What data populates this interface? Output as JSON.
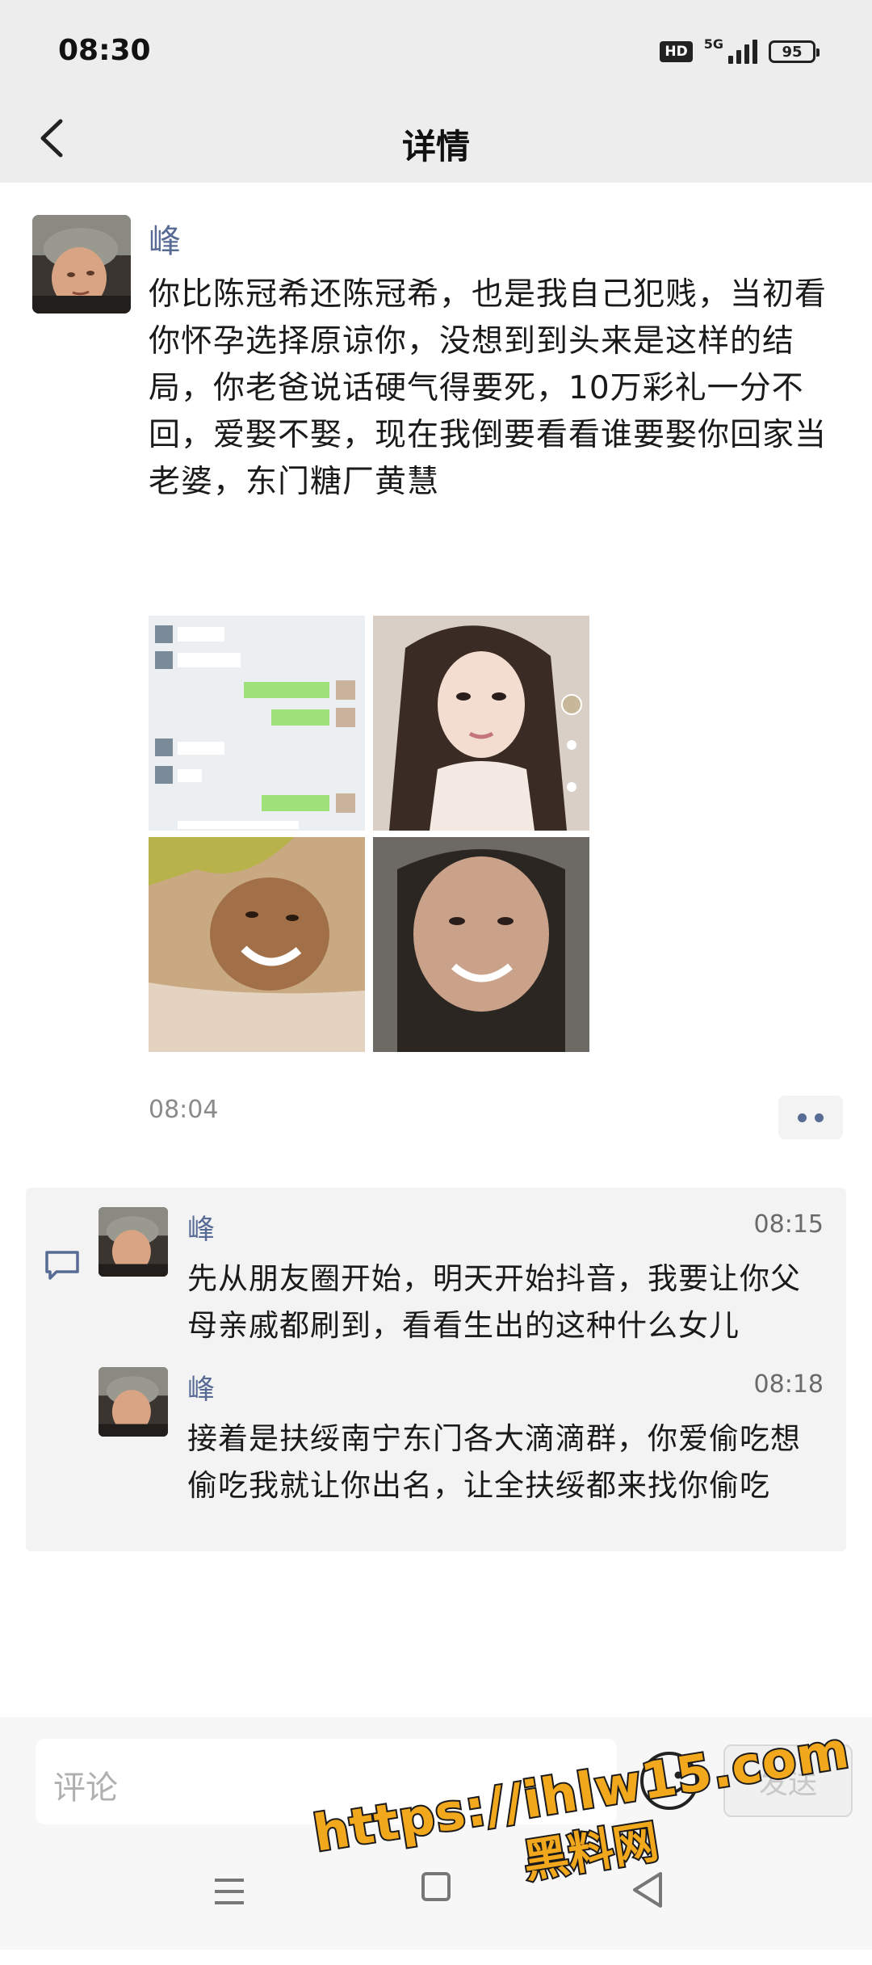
{
  "status_bar": {
    "time": "08:30",
    "hd_badge": "HD",
    "network": "5G",
    "battery": "95"
  },
  "header": {
    "back_icon": "chevron-left-icon",
    "title": "详情"
  },
  "post": {
    "author": "峰",
    "text": "你比陈冠希还陈冠希，也是我自己犯贱，当初看你怀孕选择原谅你，没想到到头来是这样的结局，你老爸说话硬气得要死，10万彩礼一分不回，爱娶不娶，现在我倒要看看谁要娶你回家当老婆，东门糖厂黄慧",
    "time": "08:04",
    "more_icon": "more-dots-icon"
  },
  "comments": [
    {
      "author": "峰",
      "time": "08:15",
      "text": "先从朋友圈开始，明天开始抖音，我要让你父母亲戚都刷到，看看生出的这种什么女儿"
    },
    {
      "author": "峰",
      "time": "08:18",
      "text": "接着是扶绥南宁东门各大滴滴群，你爱偷吃想偷吃我就让你出名，让全扶绥都来找你偷吃"
    }
  ],
  "input_bar": {
    "placeholder": "评论",
    "send_label": "发送",
    "emoji_icon": "smiley-icon"
  },
  "watermark": {
    "url": "https://ihlw15.com",
    "site": "黑料网"
  },
  "colors": {
    "link_blue": "#576b95",
    "header_bg": "#ededed",
    "comment_bg": "#f3f3f3",
    "watermark_orange": "#f2a81d"
  }
}
